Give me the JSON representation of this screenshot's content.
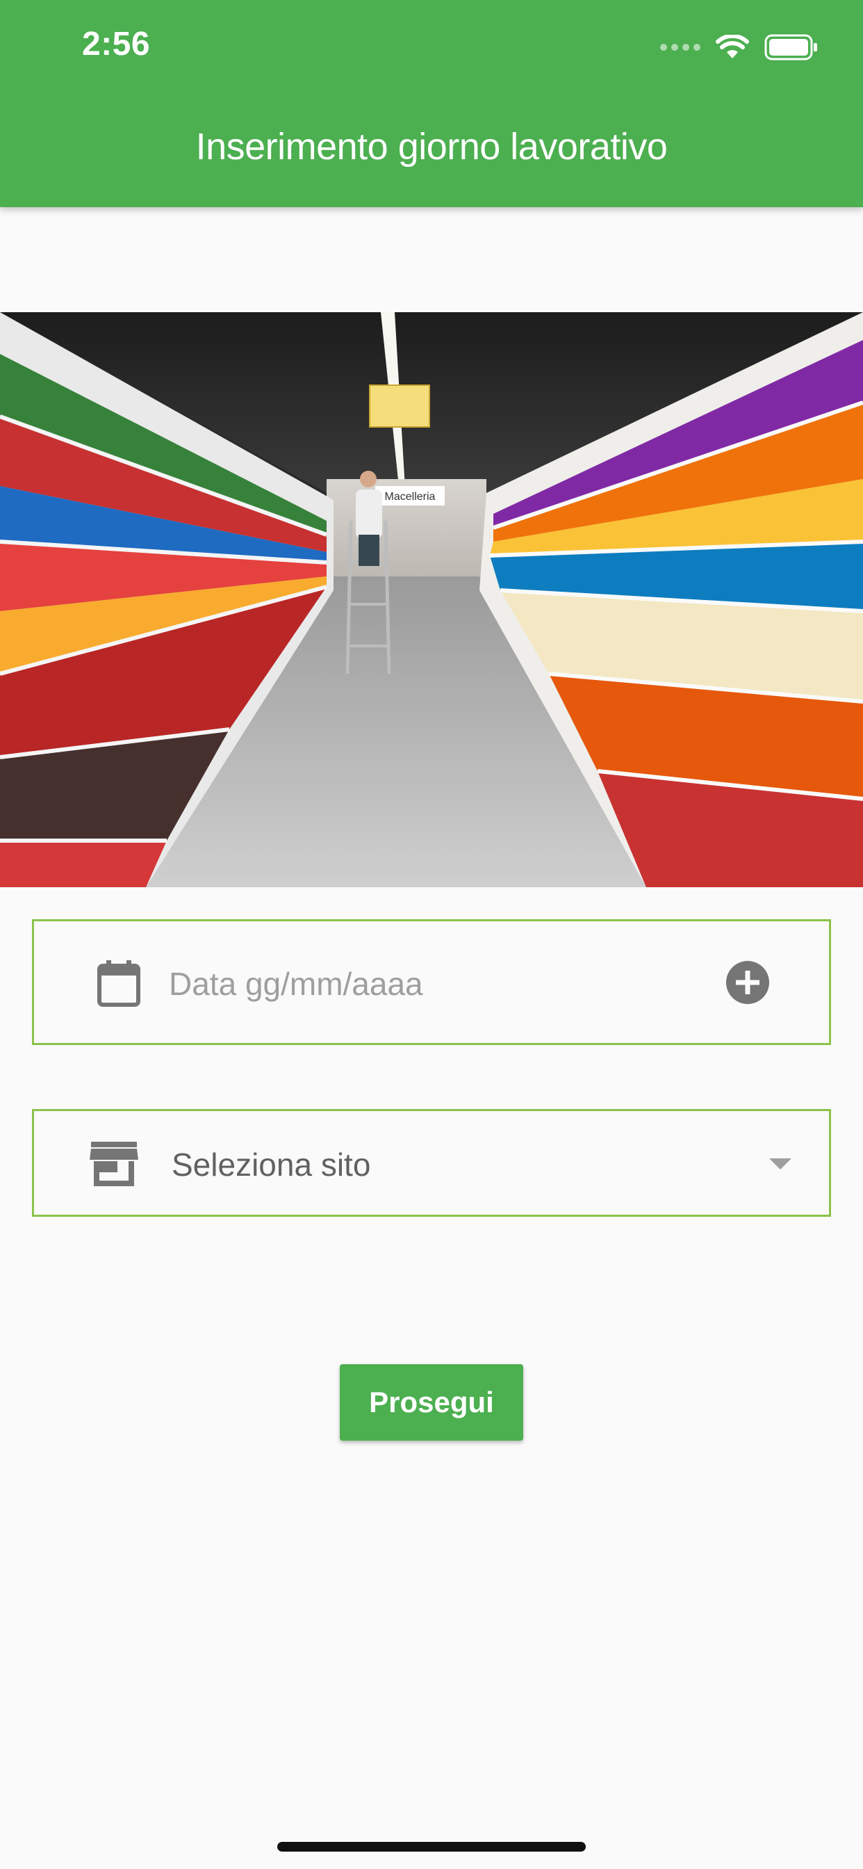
{
  "status_bar": {
    "time": "2:56",
    "icons": [
      "signal-dots-icon",
      "wifi-icon",
      "battery-icon"
    ]
  },
  "app_bar": {
    "title": "Inserimento giorno lavorativo",
    "background_color": "#4caf50"
  },
  "hero_image": {
    "subject": "supermarket aisle photo",
    "sign_text": "Macelleria"
  },
  "date_field": {
    "icon": "calendar-icon",
    "placeholder": "Data gg/mm/aaaa",
    "action_icon": "add-circle-icon"
  },
  "site_field": {
    "icon": "store-icon",
    "placeholder": "Seleziona sito",
    "action_icon": "dropdown-arrow-icon"
  },
  "actions": {
    "proceed_label": "Prosegui"
  },
  "colors": {
    "primary": "#4caf50",
    "field_border": "#8bc34a",
    "icon_grey": "#757575",
    "background": "#fafafa"
  }
}
